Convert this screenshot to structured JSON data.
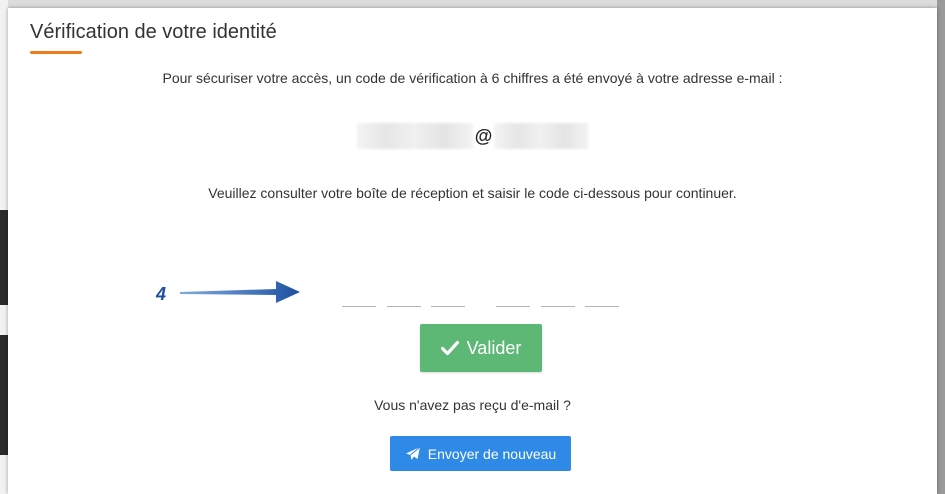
{
  "dialog": {
    "title": "Vérification de votre identité",
    "intro_text": "Pour sécuriser votre accès, un code de vérification à 6 chiffres a été envoyé à votre adresse e-mail :",
    "email_at": "@",
    "instruction_text": "Veuillez consulter votre boîte de réception et saisir le code ci-dessous pour continuer.",
    "code_length": 6,
    "code_digits": [
      "",
      "",
      "",
      "",
      "",
      ""
    ],
    "valider_label": "Valider",
    "not_received_text": "Vous n'avez pas reçu d'e-mail ?",
    "resend_label": "Envoyer de nouveau"
  },
  "annotation": {
    "number": "4"
  },
  "colors": {
    "accent_underline": "#f07c1e",
    "valider_button": "#5cb874",
    "resend_button": "#2e8ae6",
    "annotation": "#1f4f9c"
  },
  "icons": {
    "valider": "check-icon",
    "resend": "paper-plane-icon"
  }
}
